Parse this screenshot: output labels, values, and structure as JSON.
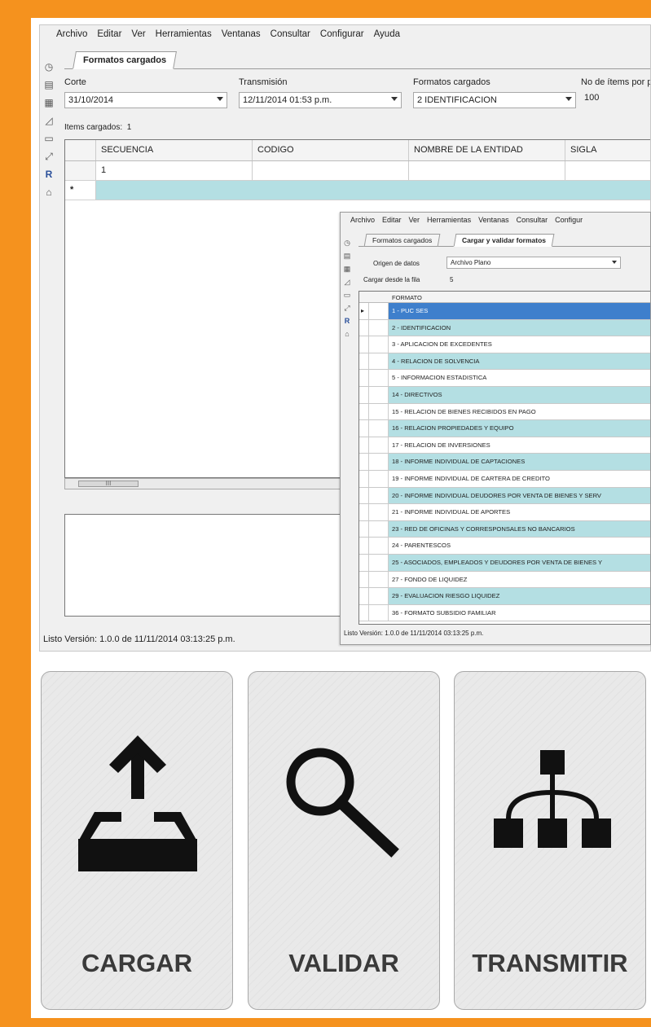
{
  "main_window": {
    "menu": [
      "Archivo",
      "Editar",
      "Ver",
      "Herramientas",
      "Ventanas",
      "Consultar",
      "Configurar",
      "Ayuda"
    ],
    "tab": "Formatos cargados",
    "fields": {
      "corte": {
        "label": "Corte",
        "value": "31/10/2014"
      },
      "transmision": {
        "label": "Transmisión",
        "value": "12/11/2014 01:53 p.m."
      },
      "formatos": {
        "label": "Formatos cargados",
        "value": "2 IDENTIFICACION"
      },
      "items_por_pagina": {
        "label": "No de ítems por pá",
        "value": "100"
      }
    },
    "items_cargados_label": "Items cargados:",
    "items_cargados_value": "1",
    "grid": {
      "columns": [
        "SECUENCIA",
        "CODIGO",
        "NOMBRE DE LA ENTIDAD",
        "SIGLA"
      ],
      "rows": [
        [
          "1",
          "",
          "",
          ""
        ]
      ],
      "new_row_marker": "*"
    },
    "scroll_thumb": "III",
    "status": "Listo  Versión:  1.0.0 de 11/11/2014 03:13:25 p.m."
  },
  "overlay_window": {
    "menu": [
      "Archivo",
      "Editar",
      "Ver",
      "Herramientas",
      "Ventanas",
      "Consultar",
      "Configur"
    ],
    "tabs": [
      "Formatos cargados",
      "Cargar y validar formatos"
    ],
    "origen_label": "Origen de datos",
    "origen_value": "Archivo Plano",
    "cargar_desde_label": "Cargar desde la fila",
    "cargar_desde_value": "5",
    "grid_header": "FORMATO",
    "current_row_marker": "▸",
    "formatos": [
      "1 - PUC SES",
      "2 - IDENTIFICACION",
      "3 - APLICACION DE EXCEDENTES",
      "4 - RELACION DE SOLVENCIA",
      "5 - INFORMACION ESTADISTICA",
      "14 - DIRECTIVOS",
      "15 - RELACION DE BIENES RECIBIDOS EN PAGO",
      "16 - RELACION PROPIEDADES Y EQUIPO",
      "17 - RELACION DE INVERSIONES",
      "18 - INFORME INDIVIDUAL DE CAPTACIONES",
      "19 - INFORME INDIVIDUAL DE CARTERA DE CREDITO",
      "20 - INFORME INDIVIDUAL DEUDORES POR VENTA DE BIENES Y SERV",
      "21 - INFORME INDIVIDUAL DE APORTES",
      "23 - RED DE OFICINAS Y CORRESPONSALES NO BANCARIOS",
      "24 - PARENTESCOS",
      "25 - ASOCIADOS, EMPLEADOS Y DEUDORES POR VENTA DE BIENES Y",
      "27 - FONDO DE LIQUIDEZ",
      "29 - EVALUACION RIESGO LIQUIDEZ",
      "36 - FORMATO SUBSIDIO FAMILIAR"
    ],
    "status": "Listo  Versión:  1.0.0 de 11/11/2014 03:13:25 p.m."
  },
  "cards": [
    {
      "label": "CARGAR",
      "icon": "upload-tray-icon"
    },
    {
      "label": "VALIDAR",
      "icon": "magnifier-icon"
    },
    {
      "label": "TRANSMITIR",
      "icon": "network-hierarchy-icon"
    }
  ],
  "colors": {
    "border": "#f5921e",
    "row_alt": "#b4dfe3",
    "row_selected": "#3e7fcc"
  }
}
